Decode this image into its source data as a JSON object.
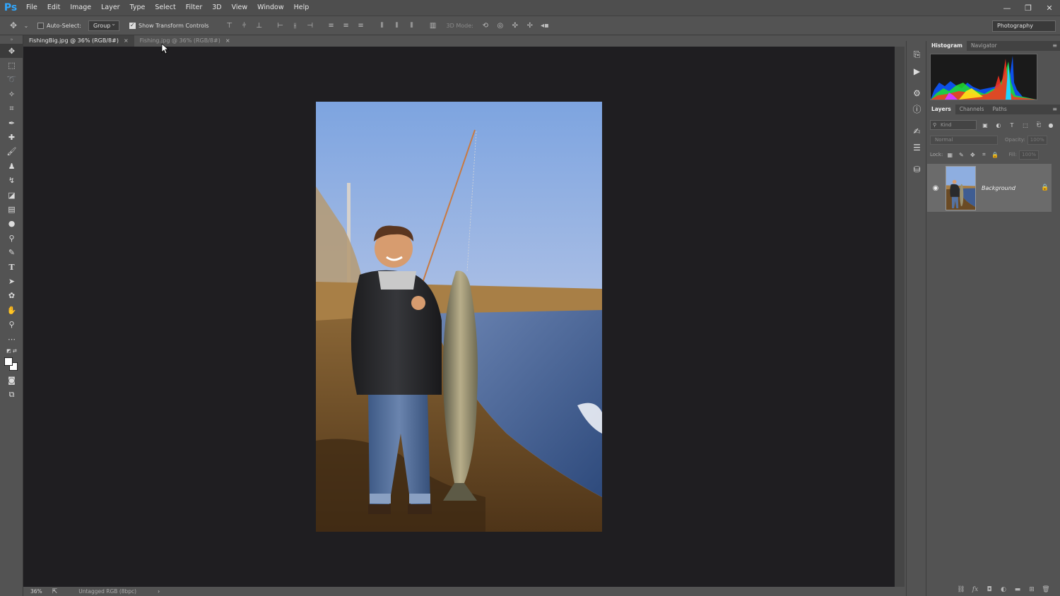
{
  "app": {
    "logo": "Ps"
  },
  "menu": [
    "File",
    "Edit",
    "Image",
    "Layer",
    "Type",
    "Select",
    "Filter",
    "3D",
    "View",
    "Window",
    "Help"
  ],
  "window_controls": {
    "minimize": "—",
    "restore": "❐",
    "close": "✕"
  },
  "options": {
    "auto_select_label": "Auto-Select:",
    "auto_select_checked": false,
    "auto_select_mode": "Group",
    "transform_label": "Show Transform Controls",
    "transform_checked": true,
    "mode_3d_label": "3D Mode:",
    "workspace": "Photography"
  },
  "tabs": [
    {
      "label": "FishingBig.jpg @ 36% (RGB/8#)",
      "active": true,
      "close": "×"
    },
    {
      "label": "Fishing.jpg @ 36% (RGB/8#)",
      "active": false,
      "close": "×"
    }
  ],
  "status": {
    "zoom": "36%",
    "profile": "Untagged RGB (8bpc)",
    "arrow": "›"
  },
  "histogram_panel": {
    "tabs": [
      "Histogram",
      "Navigator"
    ],
    "menu": "≡"
  },
  "layers_panel": {
    "tabs": [
      "Layers",
      "Channels",
      "Paths"
    ],
    "menu": "≡",
    "kind_placeholder": "Kind",
    "blend_mode": "Normal",
    "opacity_label": "Opacity:",
    "opacity_value": "100%",
    "lock_label": "Lock:",
    "fill_label": "Fill:",
    "fill_value": "100%",
    "layers": [
      {
        "name": "Background",
        "visible": true,
        "locked": true
      }
    ]
  },
  "colors": {
    "accent": "#31a8ff",
    "canvas_bg": "#1f1e21",
    "ui_bg": "#535353"
  }
}
